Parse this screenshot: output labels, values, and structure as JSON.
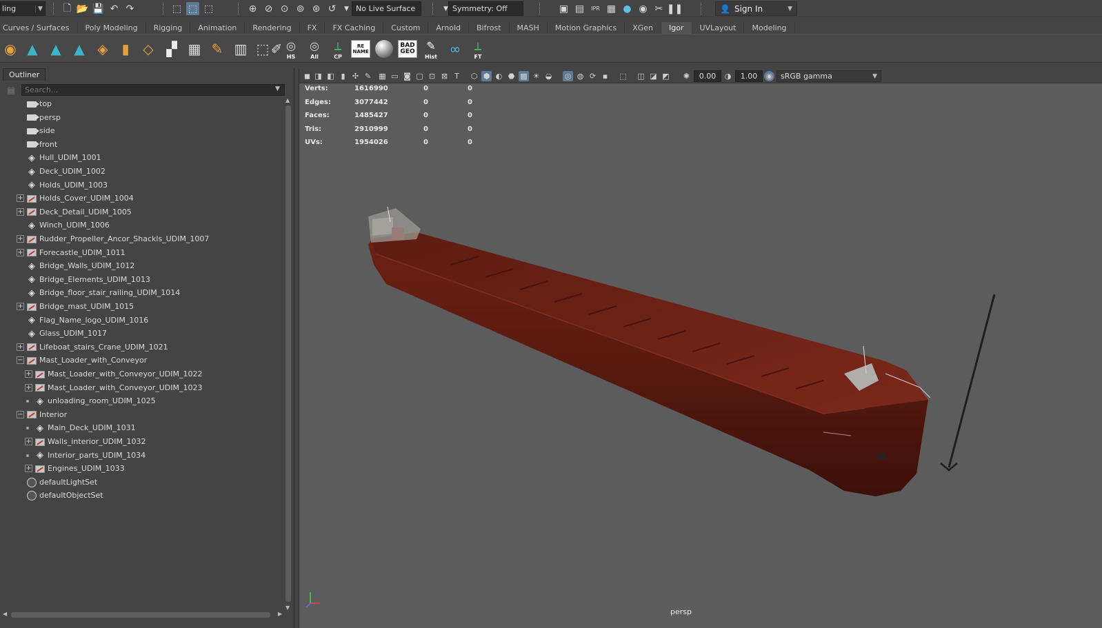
{
  "statusline": {
    "mode_menu": "ling",
    "live_surface": "No Live Surface",
    "symmetry": "Symmetry: Off",
    "sign_in": "Sign In"
  },
  "shelf_tabs": [
    "Curves / Surfaces",
    "Poly Modeling",
    "Rigging",
    "Animation",
    "Rendering",
    "FX",
    "FX Caching",
    "Custom",
    "Arnold",
    "Bifrost",
    "MASH",
    "Motion Graphics",
    "XGen",
    "Igor",
    "UVLayout",
    "Modeling"
  ],
  "active_shelf_tab": "Igor",
  "shelf_buttons": {
    "hs": "HS",
    "all": "All",
    "cp": "CP",
    "rename": "RE NAME",
    "badgeo": "BAD GEO",
    "hist": "Hist",
    "ft": "FT"
  },
  "outliner": {
    "tab": "Outliner",
    "search_placeholder": "Search...",
    "items": [
      {
        "label": "top",
        "icon": "camera-icon"
      },
      {
        "label": "persp",
        "icon": "camera-icon"
      },
      {
        "label": "side",
        "icon": "camera-icon"
      },
      {
        "label": "front",
        "icon": "camera-icon"
      },
      {
        "label": "Hull_UDIM_1001",
        "icon": "mesh-icon"
      },
      {
        "label": "Deck_UDIM_1002",
        "icon": "mesh-icon"
      },
      {
        "label": "Holds_UDIM_1003",
        "icon": "mesh-icon"
      },
      {
        "label": "Holds_Cover_UDIM_1004",
        "icon": "group-icon"
      },
      {
        "label": "Deck_Detail_UDIM_1005",
        "icon": "group-icon"
      },
      {
        "label": "Winch_UDIM_1006",
        "icon": "mesh-icon"
      },
      {
        "label": "Rudder_Propeller_Ancor_Shackls_UDIM_1007",
        "icon": "group-icon"
      },
      {
        "label": "Forecastle_UDIM_1011",
        "icon": "group-icon"
      },
      {
        "label": "Bridge_Walls_UDIM_1012",
        "icon": "mesh-icon"
      },
      {
        "label": "Bridge_Elements_UDIM_1013",
        "icon": "mesh-icon"
      },
      {
        "label": "Bridge_floor_stair_railing_UDIM_1014",
        "icon": "mesh-icon"
      },
      {
        "label": "Bridge_mast_UDIM_1015",
        "icon": "group-icon"
      },
      {
        "label": "Flag_Name_logo_UDIM_1016",
        "icon": "mesh-icon"
      },
      {
        "label": "Glass_UDIM_1017",
        "icon": "mesh-icon"
      },
      {
        "label": "Lifeboat_stairs_Crane_UDIM_1021",
        "icon": "group-icon"
      },
      {
        "label": "Mast_Loader_with_Conveyor",
        "icon": "group-icon"
      },
      {
        "label": "Mast_Loader_with_Conveyor_UDIM_1022",
        "icon": "group-icon"
      },
      {
        "label": "Mast_Loader_with_Conveyor_UDIM_1023",
        "icon": "group-icon"
      },
      {
        "label": "unloading_room_UDIM_1025",
        "icon": "mesh-icon"
      },
      {
        "label": "Interior",
        "icon": "group-icon"
      },
      {
        "label": "Main_Deck_UDIM_1031",
        "icon": "mesh-icon"
      },
      {
        "label": "Walls_interior_UDIM_1032",
        "icon": "group-icon"
      },
      {
        "label": "Interior_parts_UDIM_1034",
        "icon": "mesh-icon"
      },
      {
        "label": "Engines_UDIM_1033",
        "icon": "group-icon"
      },
      {
        "label": "defaultLightSet",
        "icon": "set-icon"
      },
      {
        "label": "defaultObjectSet",
        "icon": "set-icon"
      }
    ]
  },
  "viewport": {
    "exposure": "0.00",
    "gamma": "1.00",
    "color_space": "sRGB gamma",
    "camera_label": "persp",
    "hud": {
      "rows": [
        {
          "label": "Verts:",
          "values": [
            "1616990",
            "0",
            "0"
          ]
        },
        {
          "label": "Edges:",
          "values": [
            "3077442",
            "0",
            "0"
          ]
        },
        {
          "label": "Faces:",
          "values": [
            "1485427",
            "0",
            "0"
          ]
        },
        {
          "label": "Tris:",
          "values": [
            "2910999",
            "0",
            "0"
          ]
        },
        {
          "label": "UVs:",
          "values": [
            "1954026",
            "0",
            "0"
          ]
        }
      ]
    }
  },
  "colors": {
    "hull": "#5a1810",
    "deck": "#6b2116",
    "viewport_bg": "#5c5c5c",
    "active_tab_bg": "#5e7a95"
  }
}
